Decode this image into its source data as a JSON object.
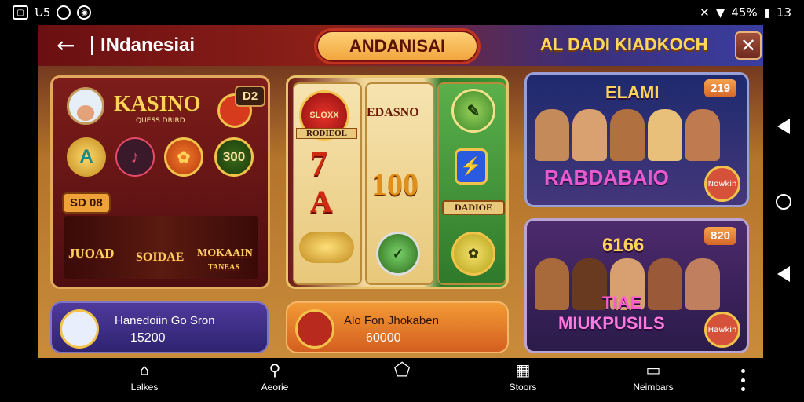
{
  "status_bar": {
    "left_icons": [
      "image-icon",
      "notification-icon",
      "circle-icon",
      "camera-icon"
    ],
    "left_text": "Ն5",
    "battery": "45%",
    "time": "13"
  },
  "header": {
    "title": "INdanesiai",
    "center_pill": "ANDANISAI",
    "right_title": "AL DADI KIADKOCH",
    "close_icon": "close-icon",
    "back_icon": "back-arrow-icon"
  },
  "cards": {
    "kasino": {
      "title": "KASINO",
      "subtitle": "QUESS DRIRD",
      "corner_badge": "D2",
      "coin_300": "300",
      "stat_badge": "SD 08",
      "strip_labels": [
        "JUOAD",
        "SOIDAE",
        "MOKAAIN"
      ],
      "strip_sub": "TANEAS"
    },
    "slots": {
      "label_left": "SLOXX",
      "label_left_sub": "RODIEOL",
      "label_mid": "EDASNO",
      "label_right": "DADIOE",
      "seven": "7",
      "a": "A",
      "hundred": "100"
    },
    "rab": {
      "corner_badge": "219",
      "top_title": "ELAMI",
      "title": "RABDABAIO",
      "pin_text": "Nowkin"
    },
    "tiae": {
      "corner_badge": "820",
      "top_title": "6166",
      "title_line1": "TIAE",
      "title_line2": "MIUKPUSILS",
      "pin_text": "Hawkin"
    }
  },
  "promos": [
    {
      "title": "Hanedoiin Go Sron",
      "value": "15200"
    },
    {
      "title": "Alo Fon Jhokaben",
      "value": "60000"
    }
  ],
  "bottom_nav": {
    "tabs": [
      {
        "label": "Lalkes",
        "icon": "home-icon"
      },
      {
        "label": "Aeorie",
        "icon": "search-icon"
      },
      {
        "label": "",
        "icon": "pentagon-home-icon"
      },
      {
        "label": "Stoors",
        "icon": "cards-icon"
      },
      {
        "label": "Neimbars",
        "icon": "wallet-icon"
      }
    ],
    "more_icon": "more-vert-icon"
  },
  "system_nav": [
    "back-icon",
    "home-circle-icon",
    "back-icon"
  ],
  "colors": {
    "accent_gold": "#ffd25a",
    "header_red": "#8c2018",
    "header_blue": "#3a3ea0",
    "promo_purple": "#4f3a9c",
    "promo_orange": "#f29a35"
  }
}
